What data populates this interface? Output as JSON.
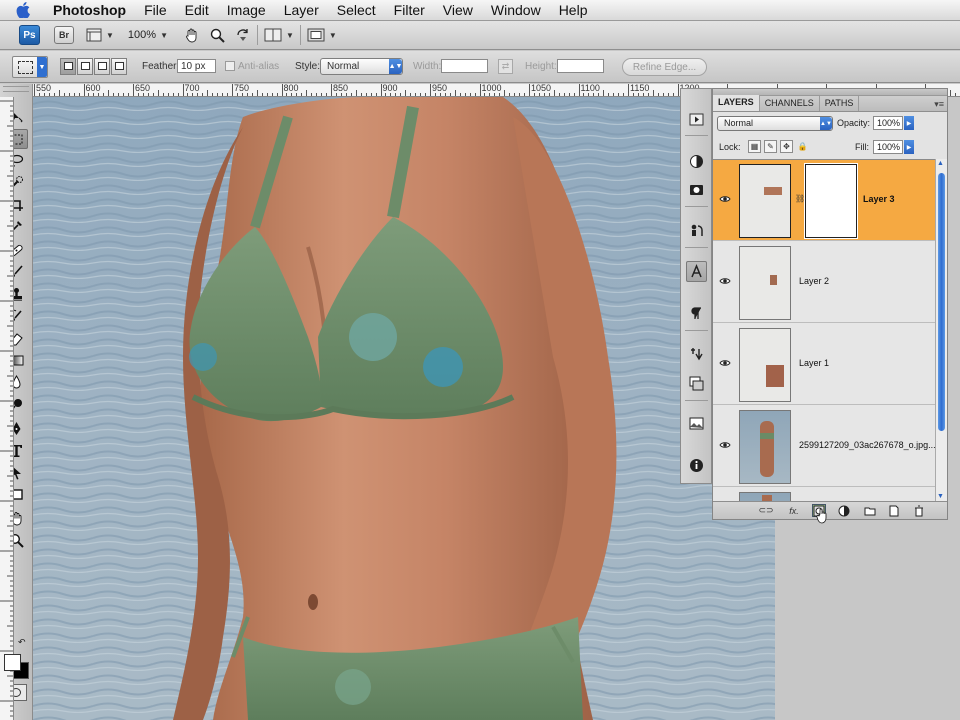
{
  "menubar": {
    "app_name": "Photoshop",
    "items": [
      "File",
      "Edit",
      "Image",
      "Layer",
      "Select",
      "Filter",
      "View",
      "Window",
      "Help"
    ]
  },
  "appbar": {
    "ps_label": "Ps",
    "br_label": "Br",
    "zoom": "100%"
  },
  "options": {
    "feather_label": "Feather:",
    "feather_value": "10 px",
    "antialias_label": "Anti-alias",
    "style_label": "Style:",
    "style_value": "Normal",
    "width_label": "Width:",
    "height_label": "Height:",
    "refine_edge": "Refine Edge..."
  },
  "ruler": {
    "labels": [
      "550",
      "600",
      "650",
      "700",
      "750",
      "800",
      "850",
      "900",
      "950",
      "1000",
      "1050",
      "1100",
      "1150",
      "1200"
    ]
  },
  "layers_panel": {
    "tabs": [
      "LAYERS",
      "CHANNELS",
      "PATHS"
    ],
    "blend_mode": "Normal",
    "opacity_label": "Opacity:",
    "opacity_value": "100%",
    "lock_label": "Lock:",
    "fill_label": "Fill:",
    "fill_value": "100%",
    "layers": [
      {
        "name": "Layer 3",
        "selected": true,
        "has_mask": true
      },
      {
        "name": "Layer 2",
        "selected": false,
        "has_mask": false
      },
      {
        "name": "Layer 1",
        "selected": false,
        "has_mask": false
      },
      {
        "name": "2599127209_03ac267678_o.jpg...",
        "selected": false,
        "has_mask": false
      }
    ],
    "footer_fx": "fx."
  },
  "colors": {
    "selected_layer": "#f5a942",
    "accent_blue": "#2a62c0"
  },
  "icons": {
    "tools": [
      "move-icon",
      "marquee-icon",
      "lasso-icon",
      "quick-select-icon",
      "crop-icon",
      "eyedropper-icon",
      "healing-icon",
      "brush-icon",
      "stamp-icon",
      "history-brush-icon",
      "eraser-icon",
      "gradient-icon",
      "blur-icon",
      "dodge-icon",
      "pen-icon",
      "type-icon",
      "path-select-icon",
      "shape-icon",
      "hand-icon",
      "zoom-icon"
    ]
  }
}
